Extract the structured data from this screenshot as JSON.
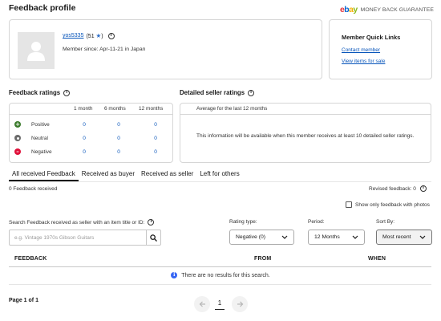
{
  "header": {
    "title": "Feedback profile",
    "brand_logo": "ebay",
    "guarantee_text": "MONEY BACK GUARANTEE"
  },
  "profile": {
    "username": "yos5335",
    "score": "(51",
    "score_close": ")",
    "star_icon": "star-icon",
    "member_since": "Member since: Apr-11-21 in Japan"
  },
  "quick_links": {
    "title": "Member Quick Links",
    "contact": "Contact member",
    "items_for_sale": "View items for sale"
  },
  "feedback_ratings": {
    "title": "Feedback ratings",
    "columns": [
      "1 month",
      "6 months",
      "12 months"
    ],
    "rows": [
      {
        "label": "Positive",
        "icon": "plus-icon",
        "color": "#3a7a2a",
        "values": [
          "0",
          "0",
          "0"
        ]
      },
      {
        "label": "Neutral",
        "icon": "neutral-icon",
        "color": "#6b6b6b",
        "values": [
          "0",
          "0",
          "0"
        ]
      },
      {
        "label": "Negative",
        "icon": "minus-icon",
        "color": "#e0103a",
        "values": [
          "0",
          "0",
          "0"
        ]
      }
    ]
  },
  "detailed_ratings": {
    "title": "Detailed seller ratings",
    "header": "Average for the last 12 months",
    "message": "This information will be available when this member receives at least 10 detailed seller ratings."
  },
  "tabs": [
    {
      "label": "All received Feedback",
      "active": true
    },
    {
      "label": "Received as buyer",
      "active": false
    },
    {
      "label": "Received as seller",
      "active": false
    },
    {
      "label": "Left for others",
      "active": false
    }
  ],
  "summary": {
    "received": "0 Feedback received",
    "revised": "Revised feedback: 0"
  },
  "filters": {
    "photos_label": "Show only feedback with photos",
    "search_label": "Search Feedback received as seller with an item title or ID:",
    "search_placeholder": "e.g. Vintage 1970s Gibson Guitars",
    "search_value": "",
    "rating_label": "Rating type:",
    "rating_value": "Negative (0)",
    "period_label": "Period:",
    "period_value": "12 Months",
    "sort_label": "Sort By:",
    "sort_value": "Most recent"
  },
  "table": {
    "headers": [
      "FEEDBACK",
      "FROM",
      "WHEN"
    ],
    "empty_message": "There are no results for this search."
  },
  "pagination": {
    "page_info": "Page 1 of 1",
    "current_page": "1"
  },
  "colors": {
    "link": "#0654ba",
    "info_accent": "#3665f3"
  }
}
